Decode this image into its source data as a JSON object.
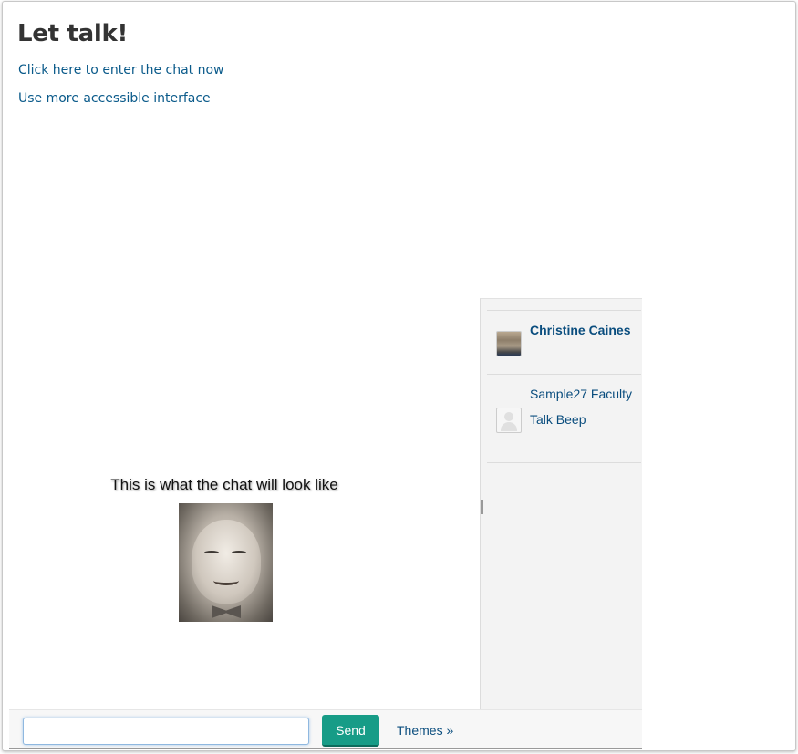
{
  "page": {
    "title": "Let talk!",
    "links": {
      "enter_chat": "Click here to enter the chat now",
      "accessible": "Use more accessible interface"
    }
  },
  "preview": {
    "caption": "This is what the chat will look like",
    "image_icon": "baby-photo"
  },
  "users": [
    {
      "name": "Christine Caines",
      "avatar_icon": "user-photo-avatar"
    },
    {
      "name": "Sample27 Faculty Talk Beep",
      "avatar_icon": "default-user-avatar"
    }
  ],
  "composer": {
    "input_value": "",
    "send_label": "Send",
    "themes_label": "Themes »"
  },
  "colors": {
    "link": "#0a5a8a",
    "send_button": "#179c87",
    "sidebar_bg": "#f3f3f3"
  }
}
